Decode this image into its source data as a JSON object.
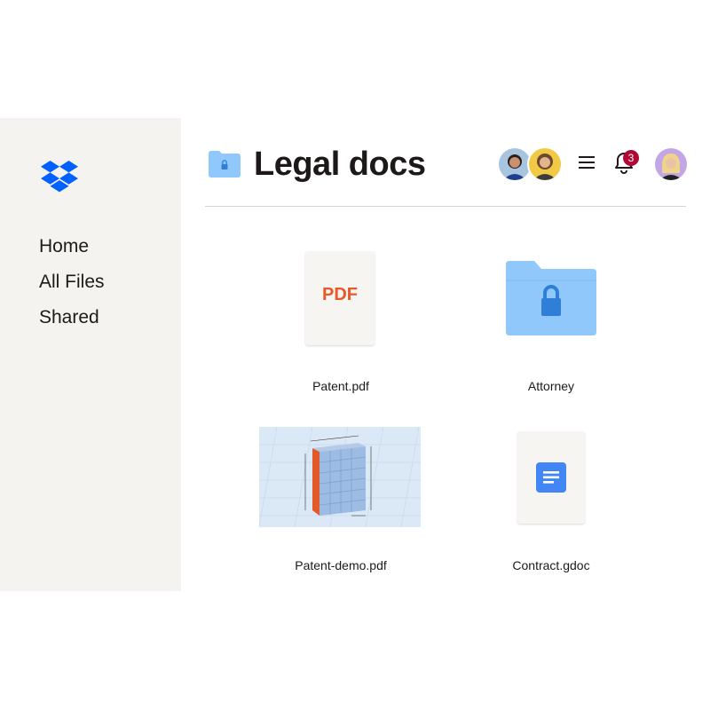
{
  "sidebar": {
    "items": [
      {
        "label": "Home"
      },
      {
        "label": "All Files"
      },
      {
        "label": "Shared"
      }
    ]
  },
  "header": {
    "title": "Legal docs",
    "notification_count": "3"
  },
  "files": [
    {
      "name": "Patent.pdf",
      "thumb_text": "PDF",
      "icon": "pdf-icon"
    },
    {
      "name": "Attorney",
      "icon": "locked-folder-icon"
    },
    {
      "name": "Patent-demo.pdf",
      "icon": "building-blueprint-thumbnail"
    },
    {
      "name": "Contract.gdoc",
      "icon": "google-doc-icon"
    }
  ],
  "colors": {
    "brand_blue": "#0061fe",
    "folder_blue": "#90c8fb",
    "pdf_orange": "#e8582b",
    "gdoc_blue": "#4285f4",
    "badge_red": "#b00834",
    "sidebar_bg": "#f5f3f0"
  }
}
